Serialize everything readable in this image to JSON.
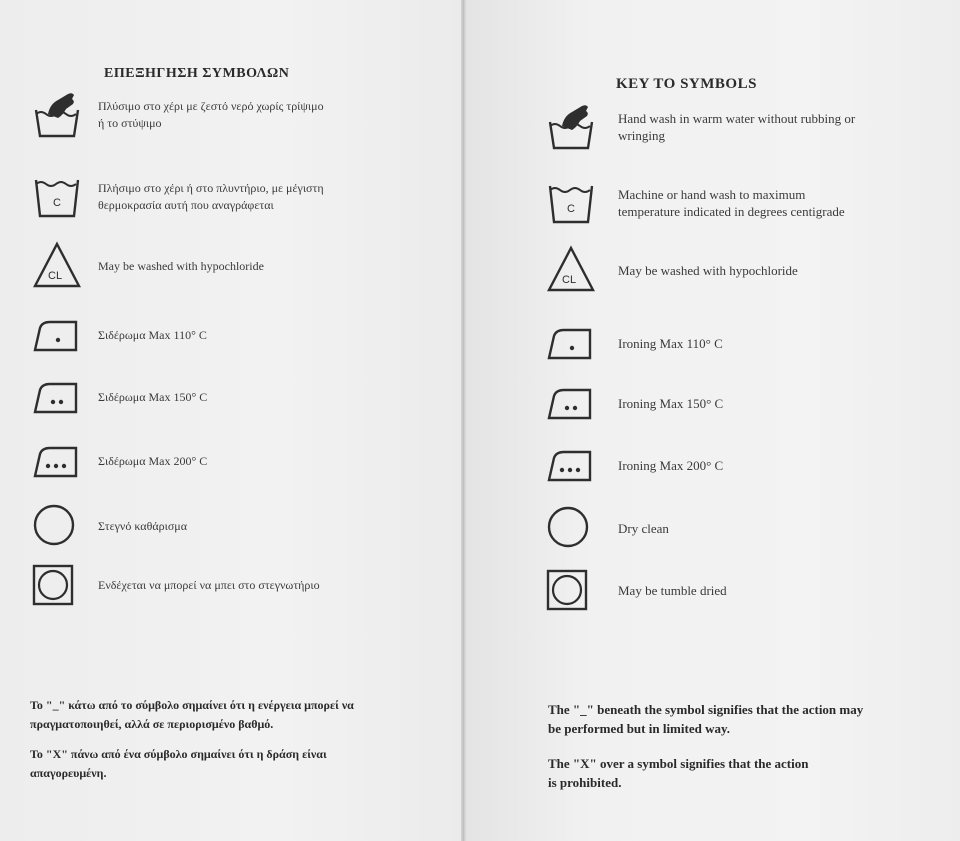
{
  "greek": {
    "title": "ΕΠΕΞΗΓΗΣΗ ΣΥΜΒΟΛΩΝ",
    "items": [
      {
        "icon": "hand-wash-icon",
        "text": "Πλύσιμο στο χέρι με ζεστό νερό χωρίς τρίψιμο ή το στύψιμο"
      },
      {
        "icon": "wash-tub-c-icon",
        "text": "Πλήσιμο στο χέρι ή στο πλυντήριο, με μέγιστη θερμοκρασία αυτή που αναγράφεται"
      },
      {
        "icon": "bleach-cl-triangle-icon",
        "text": "May be washed with hypochloride"
      },
      {
        "icon": "iron-one-dot-icon",
        "text": "Σιδέρωμα Max 110° C"
      },
      {
        "icon": "iron-two-dots-icon",
        "text": "Σιδέρωμα Max 150° C"
      },
      {
        "icon": "iron-three-dots-icon",
        "text": "Σιδέρωμα Max 200° C"
      },
      {
        "icon": "dry-clean-circle-icon",
        "text": "Στεγνό καθάρισμα"
      },
      {
        "icon": "tumble-dry-icon",
        "text": "Ενδέχεται να μπορεί να μπει στο στεγνωτήριο"
      }
    ],
    "note1": "Το \"_\" κάτω από το σύμβολο σημαίνει ότι η ενέργεια μπορεί να πραγματοποιηθεί, αλλά σε περιορισμένο βαθμό.",
    "note2": "Το \"X\" πάνω από ένα σύμβολο σημαίνει ότι η δράση είναι απαγορευμένη."
  },
  "english": {
    "title": "KEY TO SYMBOLS",
    "items": [
      {
        "icon": "hand-wash-icon",
        "text": "Hand wash in warm water without rubbing or wringing"
      },
      {
        "icon": "wash-tub-c-icon",
        "text": "Machine or hand wash to maximum temperature indicated in degrees centigrade"
      },
      {
        "icon": "bleach-cl-triangle-icon",
        "text": "May be washed with hypochloride"
      },
      {
        "icon": "iron-one-dot-icon",
        "text": "Ironing Max 110° C"
      },
      {
        "icon": "iron-two-dots-icon",
        "text": "Ironing Max 150° C"
      },
      {
        "icon": "iron-three-dots-icon",
        "text": "Ironing Max 200° C"
      },
      {
        "icon": "dry-clean-circle-icon",
        "text": "Dry clean"
      },
      {
        "icon": "tumble-dry-icon",
        "text": "May be tumble dried"
      }
    ],
    "note1": "The \"_\" beneath the symbol signifies that the action may be performed but in limited way.",
    "note2": "The \"X\" over a symbol signifies that the action is prohibited."
  },
  "symbol_text": {
    "c": "C",
    "cl": "CL"
  },
  "colors": {
    "ink": "#2e2e2e",
    "paper": "#f1f1f1"
  }
}
